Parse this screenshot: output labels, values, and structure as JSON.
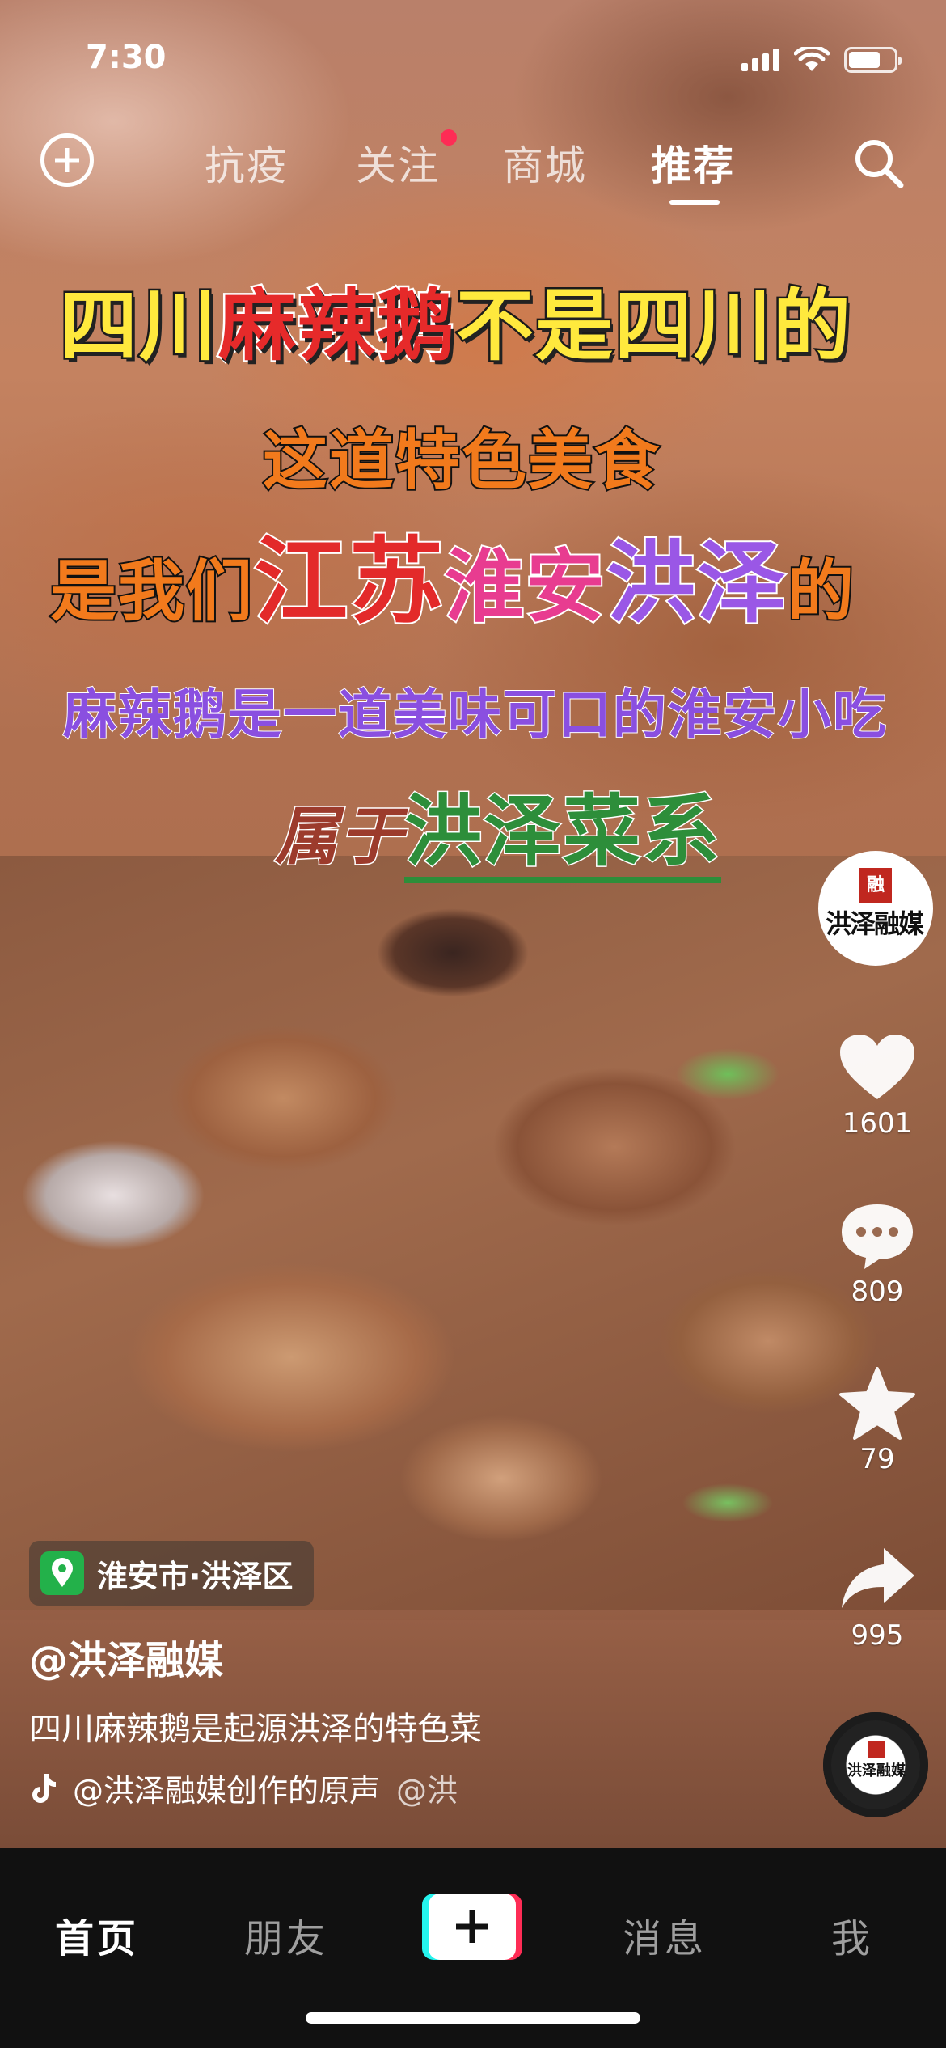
{
  "status_bar": {
    "time": "7:30"
  },
  "top_nav": {
    "tabs": [
      {
        "label": "抗疫"
      },
      {
        "label": "关注"
      },
      {
        "label": "商城"
      },
      {
        "label": "推荐"
      }
    ],
    "active_tab": "推荐"
  },
  "video_captions": {
    "line1": {
      "a": "四川",
      "b": "麻辣鹅",
      "c": "不是四川的"
    },
    "line2": "这道特色美食",
    "line3": {
      "a": "是我们",
      "b": "江苏",
      "c": "淮安",
      "d": "洪泽",
      "e": "的"
    },
    "line4": "麻辣鹅是一道美味可口的淮安小吃",
    "line5": {
      "a": "属于",
      "b": "洪泽菜系"
    }
  },
  "sidebar": {
    "avatar_text": "洪泽融媒",
    "avatar_seal": "融",
    "like_count": "1601",
    "comment_count": "809",
    "favorite_count": "79",
    "share_count": "995"
  },
  "location": {
    "text": "淮安市·洪泽区"
  },
  "post": {
    "author": "@洪泽融媒",
    "description": "四川麻辣鹅是起源洪泽的特色菜",
    "music": "@洪泽融媒创作的原声",
    "music_tail": "@洪"
  },
  "bottom_tabs": {
    "home": "首页",
    "friends": "朋友",
    "messages": "消息",
    "me": "我"
  },
  "colors": {
    "accent_red": "#fe2c55",
    "accent_cyan": "#25f4ee",
    "location_green": "#23b14a"
  }
}
